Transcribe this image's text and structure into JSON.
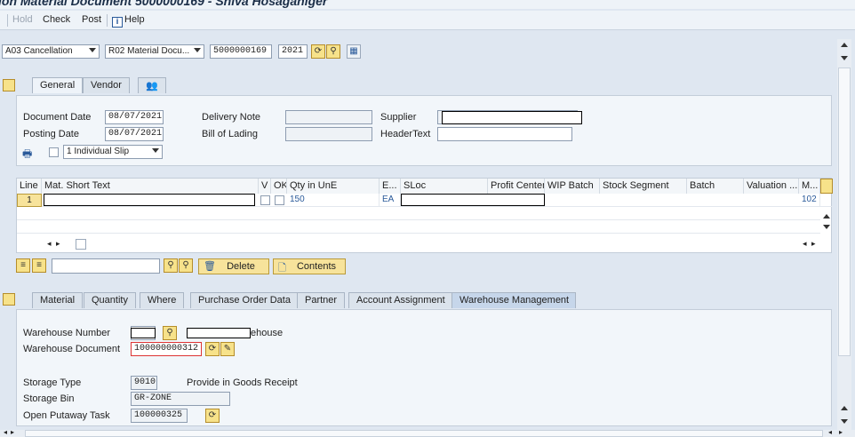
{
  "window": {
    "title": "ion Material Document 5000000169 - Shiva Hosaganiger"
  },
  "toolbar": {
    "hold": "Hold",
    "check": "Check",
    "post": "Post",
    "help": "Help"
  },
  "header_row": {
    "transaction": "A03 Cancellation",
    "reference": "R02 Material Docu...",
    "document_number": "5000000169",
    "year": "2021"
  },
  "header_tabs": [
    "General",
    "Vendor"
  ],
  "general": {
    "document_date_label": "Document Date",
    "document_date": "08/07/2021",
    "posting_date_label": "Posting Date",
    "posting_date": "08/07/2021",
    "delivery_note_label": "Delivery Note",
    "bill_of_lading_label": "Bill of Lading",
    "supplier_label": "Supplier",
    "header_text_label": "HeaderText",
    "print_option": "1 Individual Slip"
  },
  "items_table": {
    "columns": [
      "Line",
      "Mat. Short Text",
      "V",
      "OK",
      "Qty in UnE",
      "E...",
      "SLoc",
      "Profit Center",
      "WIP Batch",
      "Stock Segment",
      "Batch",
      "Valuation ...",
      "M..."
    ],
    "rows": [
      {
        "line": "1",
        "qty": "150",
        "unit": "EA",
        "movement": "102"
      }
    ]
  },
  "item_actions": {
    "delete": "Delete",
    "contents": "Contents"
  },
  "item_tabs": [
    "Material",
    "Quantity",
    "Where",
    "Purchase Order Data",
    "Partner",
    "Account Assignment",
    "Warehouse Management"
  ],
  "warehouse": {
    "warehouse_number_label": "Warehouse Number",
    "warehouse_number_desc": "ehouse",
    "warehouse_document_label": "Warehouse Document",
    "warehouse_document": "100000000312",
    "storage_type_label": "Storage Type",
    "storage_type": "9010",
    "storage_type_desc": "Provide in Goods Receipt",
    "storage_bin_label": "Storage Bin",
    "storage_bin": "GR-ZONE",
    "putaway_label": "Open Putaway Task",
    "putaway_task": "100000325"
  },
  "colors": {
    "accent": "#2a5a9a",
    "panel": "#f2f6fa",
    "button": "#f7e39b",
    "error": "#dd3333"
  }
}
